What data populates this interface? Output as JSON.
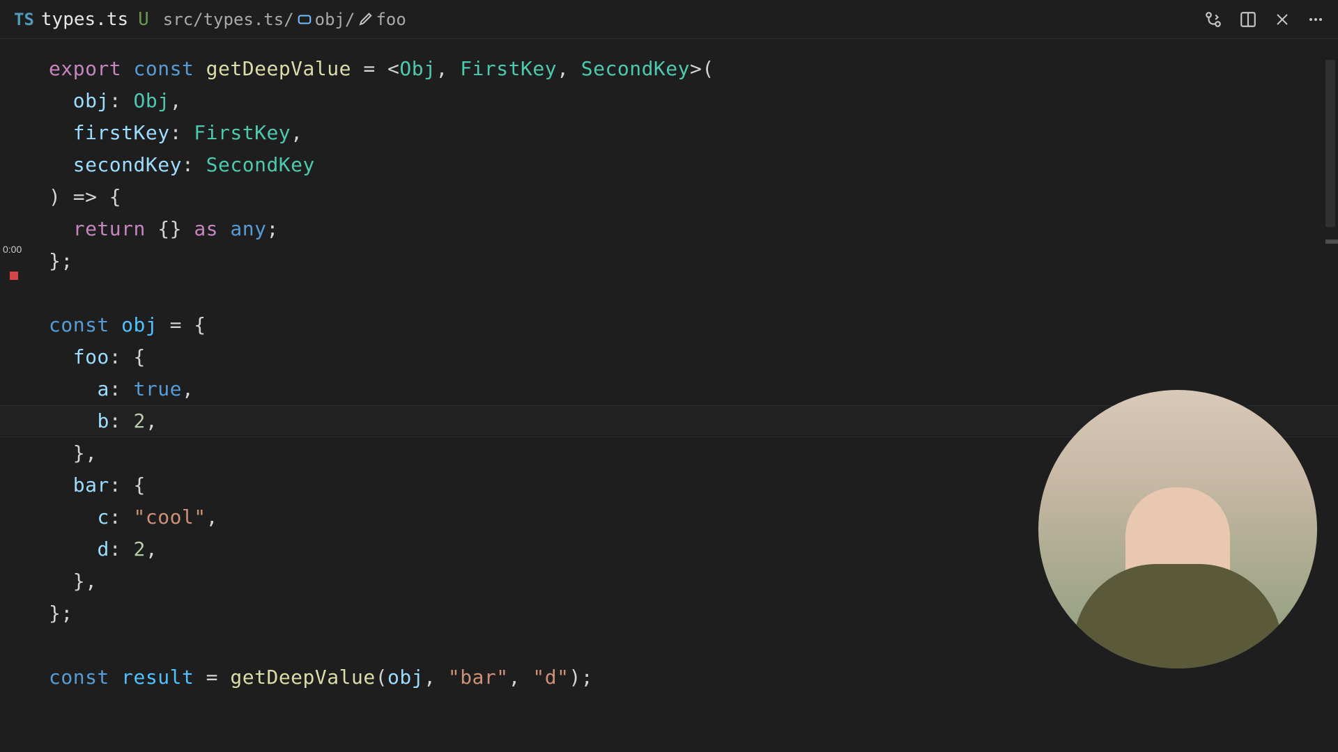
{
  "tab": {
    "lang_badge": "TS",
    "filename": "types.ts",
    "status": "U"
  },
  "breadcrumb": {
    "path": "src/types.ts/",
    "symbol1": "obj/",
    "symbol2": "foo"
  },
  "timestamp": "0:00",
  "code": {
    "l1_export": "export",
    "l1_const": "const",
    "l1_fn": "getDeepValue",
    "l1_eq": " = <",
    "l1_t1": "Obj",
    "l1_c1": ", ",
    "l1_t2": "FirstKey",
    "l1_c2": ", ",
    "l1_t3": "SecondKey",
    "l1_end": ">(",
    "l2_var": "obj",
    "l2_colon": ": ",
    "l2_type": "Obj",
    "l2_end": ",",
    "l3_var": "firstKey",
    "l3_colon": ": ",
    "l3_type": "FirstKey",
    "l3_end": ",",
    "l4_var": "secondKey",
    "l4_colon": ": ",
    "l4_type": "SecondKey",
    "l5_arrow": ") => {",
    "l6_return": "return",
    "l6_braces": " {} ",
    "l6_as": "as",
    "l6_sp": " ",
    "l6_any": "any",
    "l6_end": ";",
    "l7": "};",
    "l9_const": "const",
    "l9_sp": " ",
    "l9_var": "obj",
    "l9_eq": " = {",
    "l10_key": "foo",
    "l10_colon": ": {",
    "l11_key": "a",
    "l11_colon": ": ",
    "l11_val": "true",
    "l11_end": ",",
    "l12_key": "b",
    "l12_colon": ": ",
    "l12_val": "2",
    "l12_end": ",",
    "l13": "},",
    "l14_key": "bar",
    "l14_colon": ": {",
    "l15_key": "c",
    "l15_colon": ": ",
    "l15_val": "\"cool\"",
    "l15_end": ",",
    "l16_key": "d",
    "l16_colon": ": ",
    "l16_val": "2",
    "l16_end": ",",
    "l17": "},",
    "l18": "};",
    "l20_const": "const",
    "l20_sp": " ",
    "l20_var": "result",
    "l20_eq": " = ",
    "l20_fn": "getDeepValue",
    "l20_p1": "(",
    "l20_arg1": "obj",
    "l20_c1": ", ",
    "l20_arg2": "\"bar\"",
    "l20_c2": ", ",
    "l20_arg3": "\"d\"",
    "l20_end": ");"
  }
}
